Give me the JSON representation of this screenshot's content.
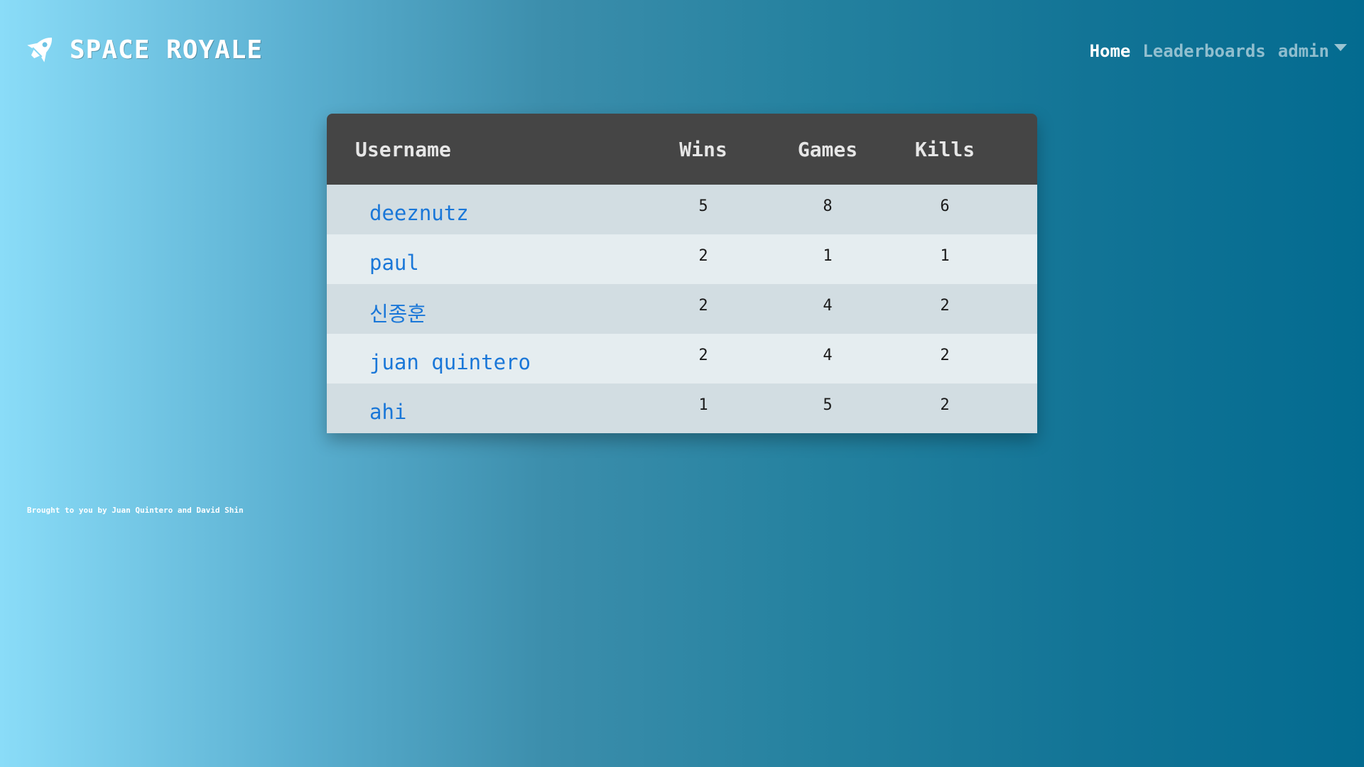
{
  "brand": {
    "title": "SPACE ROYALE",
    "icon": "rocket-icon"
  },
  "nav": {
    "home_label": "Home",
    "leaderboards_label": "Leaderboards",
    "user_menu_label": "admin",
    "user_menu_icon": "caret-down-icon"
  },
  "table": {
    "headers": {
      "username": "Username",
      "wins": "Wins",
      "games": "Games",
      "kills": "Kills"
    },
    "rows": [
      {
        "username": "deeznutz",
        "wins": "5",
        "games": "8",
        "kills": "6"
      },
      {
        "username": "paul",
        "wins": "2",
        "games": "1",
        "kills": "1"
      },
      {
        "username": "신종훈",
        "wins": "2",
        "games": "4",
        "kills": "2"
      },
      {
        "username": "juan quintero",
        "wins": "2",
        "games": "4",
        "kills": "2"
      },
      {
        "username": "ahi",
        "wins": "1",
        "games": "5",
        "kills": "2"
      }
    ]
  },
  "footer": {
    "credit": "Brought to you by Juan Quintero and David Shin"
  },
  "colors": {
    "header_bg": "#454545",
    "row_odd": "#d2dde2",
    "row_even": "#e5edf0",
    "link": "#1a77d8"
  }
}
